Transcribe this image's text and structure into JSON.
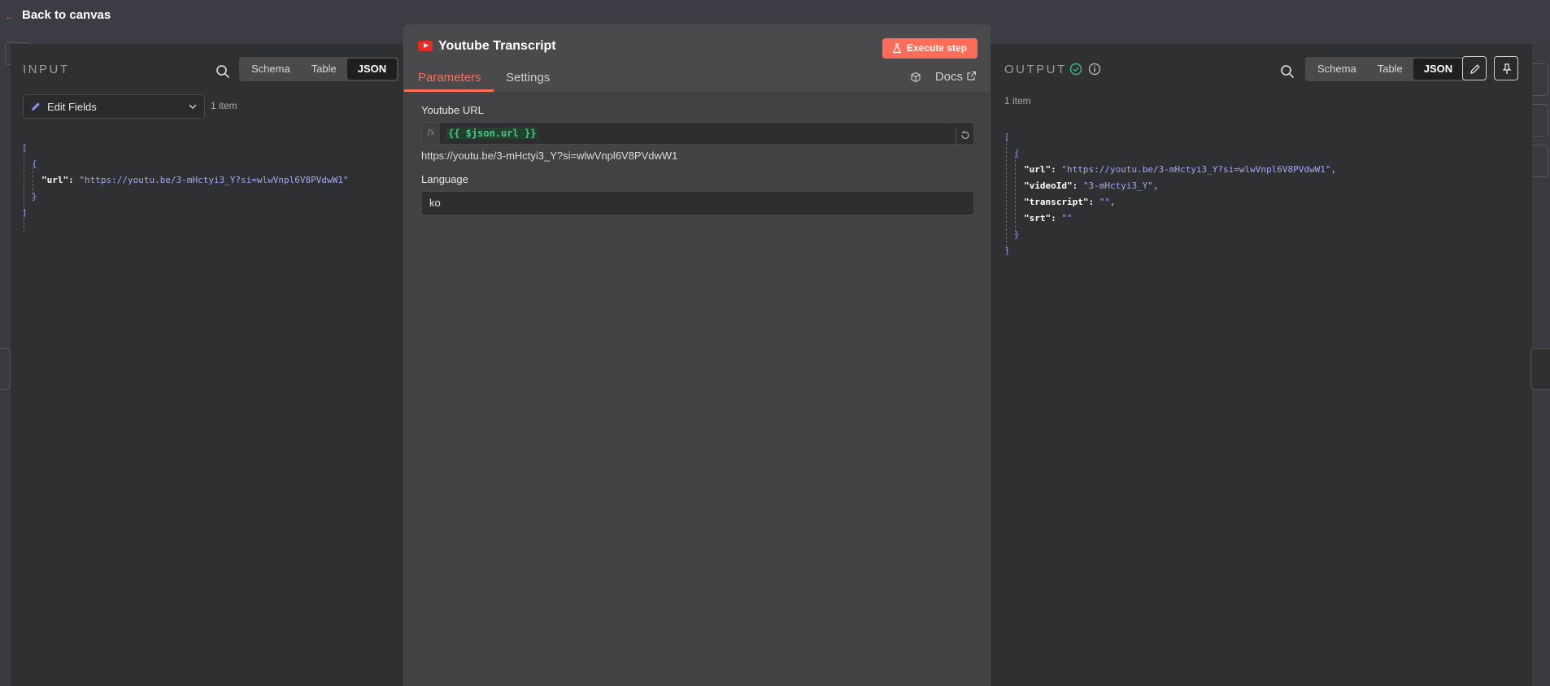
{
  "topbar": {
    "back_label": "Back to canvas"
  },
  "input": {
    "title": "INPUT",
    "views": [
      "Schema",
      "Table",
      "JSON"
    ],
    "active_view": "JSON",
    "node_select": "Edit Fields",
    "item_count": "1 item",
    "json": {
      "open": "[",
      "obj_open": "{",
      "key": "\"url\":",
      "value": "\"https://youtu.be/3-mHctyi3_Y?si=wlwVnpl6V8PVdwW1\"",
      "obj_close": "}",
      "close": "]"
    }
  },
  "modal": {
    "node_title": "Youtube Transcript",
    "execute_label": "Execute step",
    "tabs": [
      "Parameters",
      "Settings"
    ],
    "docs_label": "Docs",
    "url_label": "Youtube URL",
    "fx_label": "fx",
    "expression": "{{ $json.url }}",
    "expression_result": "https://youtu.be/3-mHctyi3_Y?si=wlwVnpl6V8PVdwW1",
    "language_label": "Language",
    "language_value": "ko"
  },
  "output": {
    "title": "OUTPUT",
    "views": [
      "Schema",
      "Table",
      "JSON"
    ],
    "active_view": "JSON",
    "item_count": "1 item",
    "json": {
      "open": "[",
      "obj_open": "{",
      "rows": [
        {
          "key": "\"url\":",
          "value": "\"https://youtu.be/3-mHctyi3_Y?si=wlwVnpl6V8PVdwW1\"",
          "comma": ","
        },
        {
          "key": "\"videoId\":",
          "value": "\"3-mHctyi3_Y\"",
          "comma": ","
        },
        {
          "key": "\"transcript\":",
          "value": "\"\"",
          "comma": ","
        },
        {
          "key": "\"srt\":",
          "value": "\"\"",
          "comma": ""
        }
      ],
      "obj_close": "}",
      "close": "]"
    }
  },
  "colors": {
    "accent": "#ff6d5a",
    "json_string": "#a6a6f6",
    "expression": "#4fc38e",
    "success": "#3fb983"
  },
  "icons": [
    "back-arrow-icon",
    "search-icon",
    "pencil-icon",
    "chevron-down-icon",
    "youtube-icon",
    "flask-icon",
    "cube-icon",
    "external-link-icon",
    "expand-icon",
    "check-circle-icon",
    "info-icon",
    "edit-icon",
    "pin-icon"
  ]
}
